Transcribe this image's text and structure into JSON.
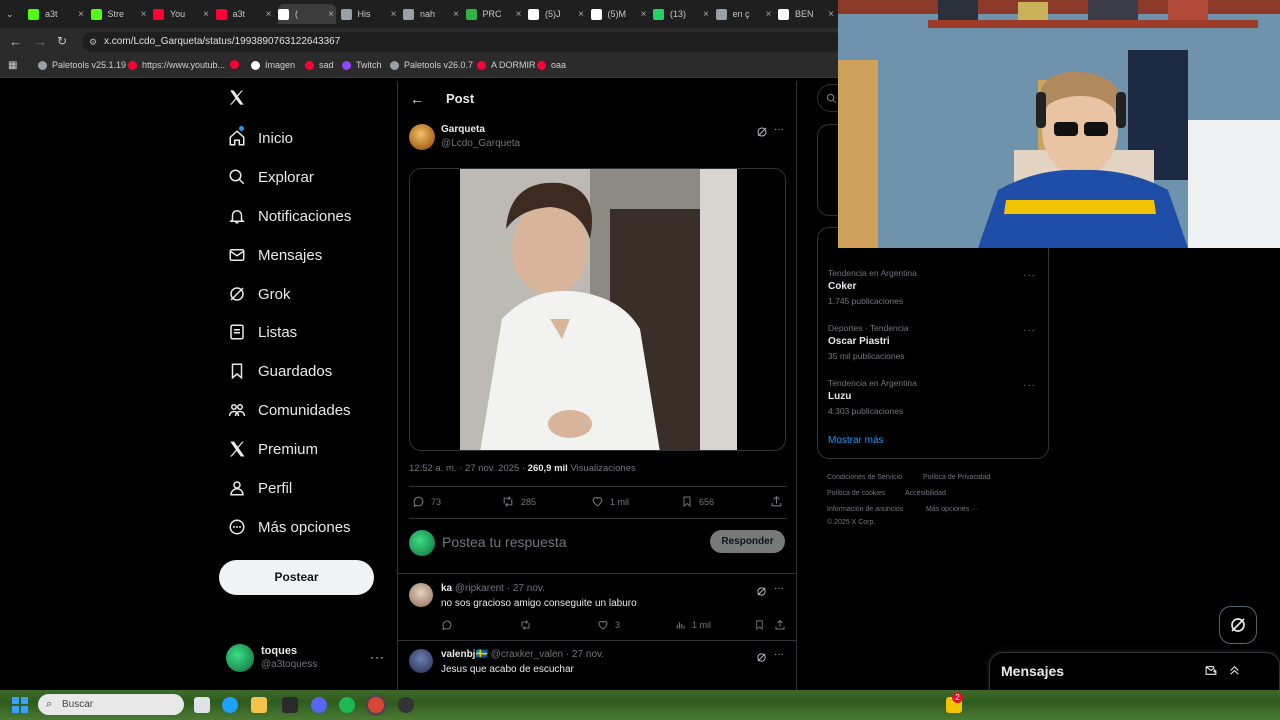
{
  "browser": {
    "tabs": [
      {
        "title": "a3t",
        "color": "#53fc18"
      },
      {
        "title": "Stre",
        "color": "#53fc18"
      },
      {
        "title": "You",
        "color": "#ff0033"
      },
      {
        "title": "a3t",
        "color": "#ff0033"
      },
      {
        "title": "(",
        "color": "#ffffff"
      },
      {
        "title": "His",
        "color": "#9aa0a6"
      },
      {
        "title": "nah",
        "color": "#9aa0a6"
      },
      {
        "title": "PRC",
        "color": "#2fb344"
      },
      {
        "title": "(5)J",
        "color": "#ffffff"
      },
      {
        "title": "(5)M",
        "color": "#ffffff"
      },
      {
        "title": "(13)",
        "color": "#25d366"
      },
      {
        "title": "en ç",
        "color": "#9aa0a6"
      },
      {
        "title": "BEN",
        "color": "#ffffff"
      },
      {
        "title": "",
        "color": "#9aa0a6"
      }
    ],
    "url": "x.com/Lcdo_Garqueta/status/1993890763122643367",
    "bookmarks": [
      {
        "label": "Paletools v25.1.19",
        "color": "#9aa0a6"
      },
      {
        "label": "https://www.youtub...",
        "color": "#ff0033"
      },
      {
        "label": "",
        "color": "#ff0033"
      },
      {
        "label": "Imagen",
        "color": "#ffffff"
      },
      {
        "label": "sad",
        "color": "#ff0033"
      },
      {
        "label": "Twitch",
        "color": "#9146ff"
      },
      {
        "label": "Paletools v26.0.7",
        "color": "#9aa0a6"
      },
      {
        "label": "A DORMIR",
        "color": "#ff0033"
      },
      {
        "label": "oaa",
        "color": "#ff0033"
      }
    ]
  },
  "nav": {
    "items": [
      {
        "label": "Inicio",
        "icon": "home-icon"
      },
      {
        "label": "Explorar",
        "icon": "search-icon"
      },
      {
        "label": "Notificaciones",
        "icon": "bell-icon"
      },
      {
        "label": "Mensajes",
        "icon": "envelope-icon"
      },
      {
        "label": "Grok",
        "icon": "grok-icon"
      },
      {
        "label": "Listas",
        "icon": "list-icon"
      },
      {
        "label": "Guardados",
        "icon": "bookmark-icon"
      },
      {
        "label": "Comunidades",
        "icon": "communities-icon"
      },
      {
        "label": "Premium",
        "icon": "x-logo-icon"
      },
      {
        "label": "Perfil",
        "icon": "person-icon"
      },
      {
        "label": "Más opciones",
        "icon": "more-circle-icon"
      }
    ],
    "post_button": "Postear",
    "account": {
      "name": "toques",
      "handle": "@a3toquess"
    }
  },
  "post": {
    "header_title": "Post",
    "author_name": "Garqueta",
    "author_handle": "@Lcdo_Garqueta",
    "timestamp": "12:52 a. m. · 27 nov. 2025 ·",
    "views_count": "260,9 mil",
    "views_label": "Visualizaciones",
    "replies": "73",
    "reposts": "285",
    "likes": "1 mil",
    "bookmarks": "656"
  },
  "reply_box": {
    "placeholder": "Postea tu respuesta",
    "button": "Responder"
  },
  "replies": [
    {
      "name": "ka",
      "meta": "@ripkarent · 27 nov.",
      "text": "no sos gracioso amigo conseguite un laburo",
      "reposts": "",
      "likes": "3",
      "views": "1 mil"
    },
    {
      "name": "valenbj🇸🇪",
      "meta": "@craxker_valen · 27 nov.",
      "text": "Jesus que acabo de escuchar"
    }
  ],
  "trends": {
    "items": [
      {
        "category": "Tendencia en Argentina",
        "name": "Coker",
        "count": "1.745 publicaciones"
      },
      {
        "category": "Deportes · Tendencia",
        "name": "Oscar Piastri",
        "count": "35 mil publicaciones"
      },
      {
        "category": "Tendencia en Argentina",
        "name": "Luzu",
        "count": "4.303 publicaciones"
      }
    ],
    "show_more": "Mostrar más"
  },
  "footer": {
    "links": [
      "Condiciones de Servicio",
      "Política de Privacidad",
      "Política de cookies",
      "Accesibilidad",
      "Información de anuncios",
      "Más opciones ···"
    ],
    "copyright": "© 2025 X Corp."
  },
  "messages_dock": {
    "title": "Mensajes"
  },
  "taskbar": {
    "search_placeholder": "Buscar",
    "notification_count": "2"
  }
}
